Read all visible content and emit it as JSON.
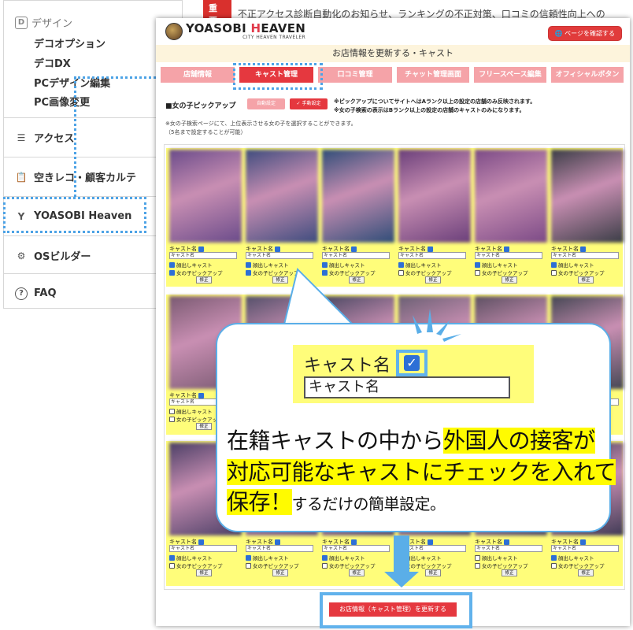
{
  "sidebar": {
    "design_header": "デザイン",
    "design_items": [
      "デコオプション",
      "デコDX",
      "PCデザイン編集",
      "PC画像変更"
    ],
    "access": "アクセス",
    "vacancy": "空きレコ・顧客カルテ",
    "yoasobi": "YOASOBI Heaven",
    "osbuilder": "OSビルダー",
    "faq": "FAQ"
  },
  "notice": {
    "badge": "重要",
    "text": "不正アクセス診断自動化のお知らせ、ランキングの不正対策、口コミの信頼性向上への"
  },
  "app": {
    "logo_main": "YOASOBI ",
    "logo_accent": "H",
    "logo_rest": "EAVEN",
    "logo_tag": "CITY HEAVEN TRAVELER",
    "view_page_button": "ページを確認する",
    "page_title": "お店情報を更新する・キャスト"
  },
  "tabs": [
    {
      "label": "店舗情報",
      "active": false
    },
    {
      "label": "キャスト管理",
      "active": true
    },
    {
      "label": "口コミ管理",
      "active": false
    },
    {
      "label": "チャット管理画面",
      "active": false
    },
    {
      "label": "フリースペース編集",
      "active": false
    },
    {
      "label": "オフィシャルボタン",
      "active": false
    }
  ],
  "pickup": {
    "title": "■女の子ピックアップ",
    "auto_button": "自動設定",
    "manual_button": "✓ 手動設定",
    "note1": "※ピックアップについてサイトへはAランク以上の設定の店舗のみ反映されます。",
    "note2": "※女の子検索の表示はBランク以上の設定の店舗のキャストのみになります。",
    "desc1": "※女の子検索ページにて、上位表示させる女の子を選択することができます。",
    "desc2": "（5名まで設定することが可能）"
  },
  "card_text": {
    "label": "キャスト名",
    "input": "キャスト名",
    "face": "顔出しキャスト",
    "pickup": "女の子ピックアップ",
    "edit": "修正"
  },
  "rows": [
    [
      {
        "face": true,
        "pick": true,
        "color": "#6a4b8a"
      },
      {
        "face": true,
        "pick": true,
        "color": "#3e4c7e"
      },
      {
        "face": true,
        "pick": true,
        "color": "#2f4d78"
      },
      {
        "face": true,
        "pick": false,
        "color": "#6a3f7a"
      },
      {
        "face": true,
        "pick": false,
        "color": "#7b4a86"
      },
      {
        "face": true,
        "pick": false,
        "color": "#3a3d46"
      }
    ],
    [
      {
        "face": false,
        "pick": false,
        "color": "#7a5a72"
      },
      {
        "face": false,
        "pick": false,
        "color": "#54506a"
      },
      {
        "face": false,
        "pick": false,
        "color": "#4a4862"
      },
      {
        "face": false,
        "pick": false,
        "color": "#6b6074"
      },
      {
        "face": false,
        "pick": false,
        "color": "#5d5062"
      },
      {
        "face": false,
        "pick": false,
        "color": "#454754"
      }
    ],
    [
      {
        "face": true,
        "pick": false,
        "color": "#4b3f66"
      },
      {
        "face": true,
        "pick": false,
        "color": "#6b5280"
      },
      {
        "face": true,
        "pick": false,
        "color": "#564a70"
      },
      {
        "face": false,
        "pick": false,
        "color": "#5c4f6d"
      },
      {
        "face": false,
        "pick": false,
        "color": "#4f4a66"
      },
      {
        "face": true,
        "pick": false,
        "color": "#3f3a55"
      }
    ]
  ],
  "callout": {
    "zoom_label": "キャスト名",
    "zoom_input": "キャスト名",
    "line1_a": "在籍キャストの中から",
    "line1_b": "外国人の接客が",
    "line2": "対応可能なキャストにチェックを入れて",
    "line3_a": "保存！",
    "line3_b": "するだけの簡単設定。"
  },
  "save_button": "お店情報（キャスト管理）を更新する",
  "colors": {
    "accent": "#e5383f",
    "highlight": "#4da3e6",
    "card_bg": "#fffd7a"
  }
}
